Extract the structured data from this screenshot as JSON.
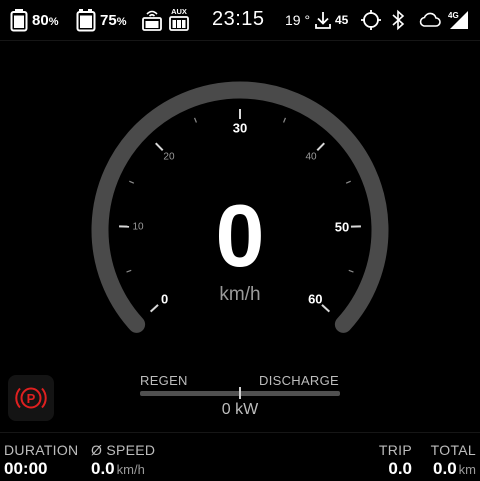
{
  "status_bar": {
    "battery_1": {
      "value": "80",
      "unit": "%"
    },
    "battery_2": {
      "value": "75",
      "unit": "%"
    },
    "aux_label": "AUX",
    "clock": "23:15",
    "temperature": "19 °",
    "download_count": "45",
    "network": "4G"
  },
  "speedometer": {
    "speed": "0",
    "unit": "km/h",
    "min": 0,
    "max": 60,
    "major_ticks": [
      "0",
      "30",
      "50",
      "60"
    ],
    "minor_ticks": [
      "10",
      "20",
      "40"
    ]
  },
  "parking_brake": {
    "symbol": "P",
    "color": "#e02020"
  },
  "power": {
    "regen_label": "REGEN",
    "discharge_label": "DISCHARGE",
    "value": "0 kW",
    "level": 0
  },
  "footer": {
    "duration": {
      "label": "DURATION",
      "value": "00:00"
    },
    "avg_speed": {
      "label": "Ø SPEED",
      "value": "0.0",
      "unit": "km/h"
    },
    "trip": {
      "label": "TRIP",
      "value": "0.0"
    },
    "total": {
      "label": "TOTAL",
      "value": "0.0",
      "unit": "km"
    }
  },
  "colors": {
    "background": "#000000",
    "gauge_arc": "#4a4a4a",
    "warning_red": "#e02020",
    "secondary_text": "#bdbdbd"
  }
}
